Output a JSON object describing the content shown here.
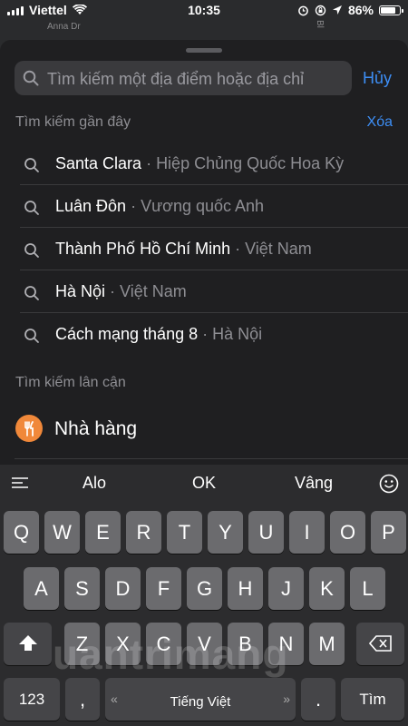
{
  "status_bar": {
    "carrier": "Viettel",
    "time": "10:35",
    "battery": "86%",
    "battery_level": 0.86
  },
  "map": {
    "street_label": "Anna Dr",
    "street_label_2": "Bl"
  },
  "search": {
    "placeholder": "Tìm kiếm một địa điểm hoặc địa chỉ",
    "cancel_label": "Hủy"
  },
  "recent": {
    "title": "Tìm kiếm gần đây",
    "clear_label": "Xóa",
    "items": [
      {
        "place": "Santa Clara",
        "region": "Hiệp Chủng Quốc Hoa Kỳ"
      },
      {
        "place": "Luân Đôn",
        "region": "Vương quốc Anh"
      },
      {
        "place": "Thành Phố Hồ Chí Minh",
        "region": "Việt Nam"
      },
      {
        "place": "Hà Nội",
        "region": "Việt Nam"
      },
      {
        "place": "Cách mạng tháng 8",
        "region": "Hà Nội"
      }
    ],
    "separator": "·"
  },
  "nearby": {
    "title": "Tìm kiếm lân cận",
    "items": [
      {
        "label": "Nhà hàng",
        "icon": "fork-knife-icon",
        "color": "#f0883a"
      }
    ]
  },
  "keyboard": {
    "suggestions": [
      "Alo",
      "OK",
      "Vâng"
    ],
    "row1": [
      "Q",
      "W",
      "E",
      "R",
      "T",
      "Y",
      "U",
      "I",
      "O",
      "P"
    ],
    "row2": [
      "A",
      "S",
      "D",
      "F",
      "G",
      "H",
      "J",
      "K",
      "L"
    ],
    "row3": [
      "Z",
      "X",
      "C",
      "V",
      "B",
      "N",
      "M"
    ],
    "numbers_label": "123",
    "comma_label": ",",
    "space_label": "Tiếng Việt",
    "period_label": ".",
    "search_label": "Tìm"
  },
  "watermark": "uantrimang",
  "colors": {
    "accent": "#3d8ef5",
    "key": "#6b6b6e",
    "key_dark": "#454548"
  }
}
